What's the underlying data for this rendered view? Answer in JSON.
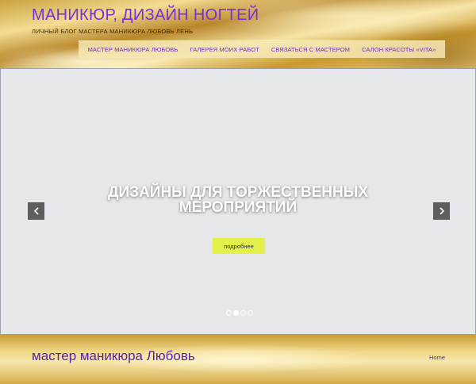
{
  "header": {
    "site_title": "МАНИКЮР, ДИЗАЙН НОГТЕЙ",
    "tagline": "ЛИЧНЫЙ БЛОГ МАСТЕРА МАНИКЮРА ЛЮБОВЬ ЛЕНЬ"
  },
  "nav": {
    "items": [
      {
        "label": "МАСТЕР МАНИКЮРА ЛЮБОВЬ"
      },
      {
        "label": "ГАЛЕРЕЯ МОИХ РАБОТ"
      },
      {
        "label": "СВЯЗАТЬСЯ С МАСТЕРОМ"
      },
      {
        "label": "САЛОН КРАСОТЫ «VITA»"
      }
    ]
  },
  "slider": {
    "title_line1": "ДИЗАЙНЫ ДЛЯ ТОРЖЕСТВЕННЫХ",
    "title_line2": "МЕРОПРИЯТИЙ",
    "button_label": "подробнее",
    "slide_count": 4,
    "active_slide": 2,
    "prev_icon": "chevron-left-icon",
    "next_icon": "chevron-right-icon"
  },
  "page": {
    "heading": "мастер маникюра Любовь",
    "breadcrumb_home": "Home"
  },
  "colors": {
    "title": "#7b2fd6",
    "nav_text": "#6a2fb8",
    "button_bg": "#e2f04a",
    "heading": "#5a1fa8"
  }
}
